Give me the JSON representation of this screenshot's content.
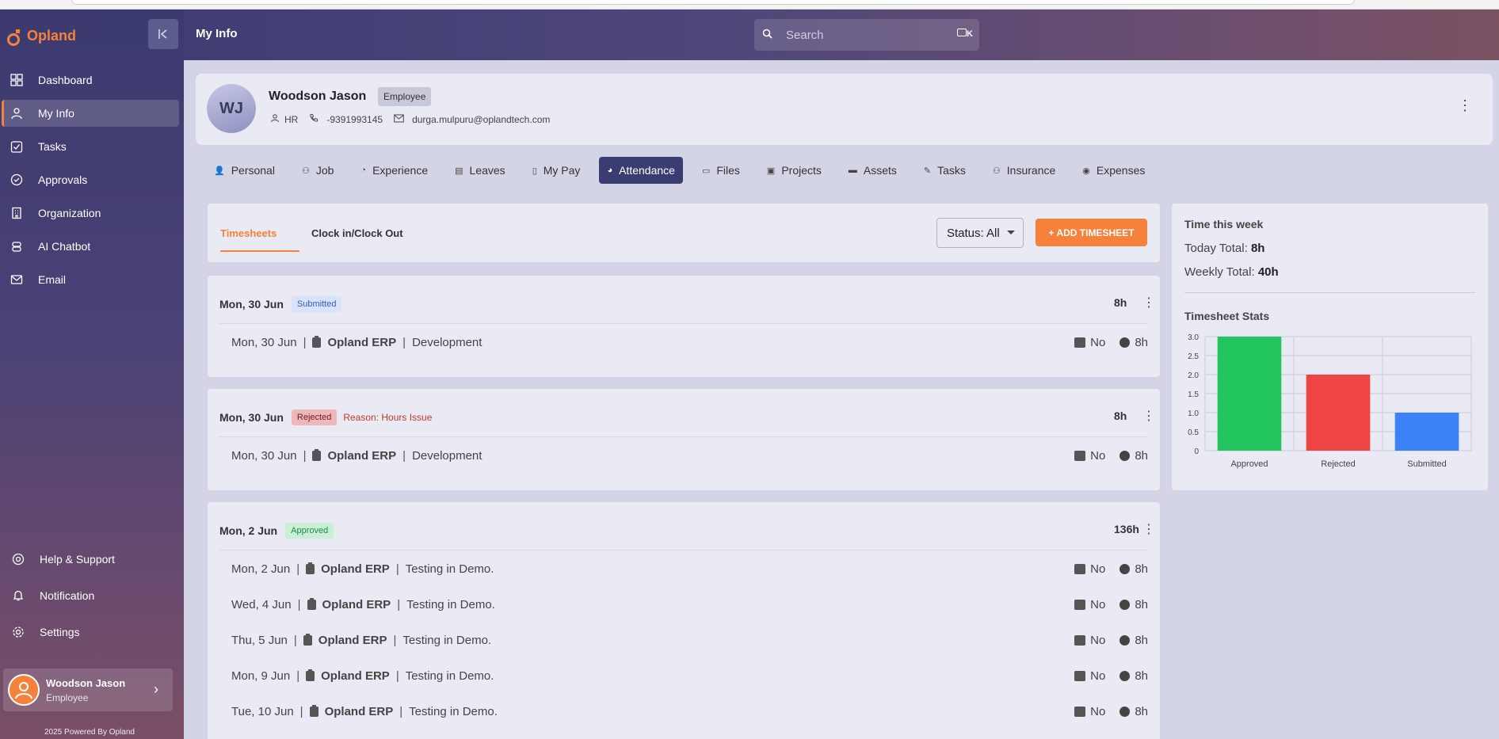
{
  "brand": {
    "name": "Opland"
  },
  "header": {
    "title": "My Info",
    "search_placeholder": "Search",
    "shortcut": "K"
  },
  "nav": {
    "items": [
      {
        "label": "Dashboard",
        "icon": "dashboard-icon"
      },
      {
        "label": "My Info",
        "icon": "user-icon",
        "active": true
      },
      {
        "label": "Tasks",
        "icon": "tasks-icon"
      },
      {
        "label": "Approvals",
        "icon": "approvals-icon"
      },
      {
        "label": "Organization",
        "icon": "organization-icon"
      },
      {
        "label": "AI Chatbot",
        "icon": "chatbot-icon"
      },
      {
        "label": "Email",
        "icon": "email-icon"
      }
    ],
    "bottom": [
      {
        "label": "Help & Support",
        "icon": "help-icon"
      },
      {
        "label": "Notification",
        "icon": "bell-icon"
      },
      {
        "label": "Settings",
        "icon": "gear-icon"
      }
    ]
  },
  "user": {
    "name": "Woodson Jason",
    "role": "Employee"
  },
  "footer": "2025 Powered By Opland",
  "profile": {
    "initials": "WJ",
    "name": "Woodson Jason",
    "badge": "Employee",
    "department": "HR",
    "phone": "-9391993145",
    "email": "durga.mulpuru@oplandtech.com"
  },
  "tabs": [
    "Personal",
    "Job",
    "Experience",
    "Leaves",
    "My Pay",
    "Attendance",
    "Files",
    "Projects",
    "Assets",
    "Tasks",
    "Insurance",
    "Expenses"
  ],
  "active_tab": "Attendance",
  "timesheet": {
    "tabs": [
      "Timesheets",
      "Clock in/Clock Out"
    ],
    "status_filter": "Status: All",
    "add_button": "+ ADD TIMESHEET",
    "groups": [
      {
        "date": "Mon, 30 Jun",
        "status": "Submitted",
        "reason": "",
        "hours": "8h",
        "entries": [
          {
            "date": "Mon, 30 Jun",
            "project": "Opland ERP",
            "task": "Development",
            "billable": "No",
            "hours": "8h"
          }
        ]
      },
      {
        "date": "Mon, 30 Jun",
        "status": "Rejected",
        "reason": "Reason: Hours Issue",
        "hours": "8h",
        "entries": [
          {
            "date": "Mon, 30 Jun",
            "project": "Opland ERP",
            "task": "Development",
            "billable": "No",
            "hours": "8h"
          }
        ]
      },
      {
        "date": "Mon, 2 Jun",
        "status": "Approved",
        "reason": "",
        "hours": "136h",
        "entries": [
          {
            "date": "Mon, 2 Jun",
            "project": "Opland ERP",
            "task": "Testing in Demo.",
            "billable": "No",
            "hours": "8h"
          },
          {
            "date": "Wed, 4 Jun",
            "project": "Opland ERP",
            "task": "Testing in Demo.",
            "billable": "No",
            "hours": "8h"
          },
          {
            "date": "Thu, 5 Jun",
            "project": "Opland ERP",
            "task": "Testing in Demo.",
            "billable": "No",
            "hours": "8h"
          },
          {
            "date": "Mon, 9 Jun",
            "project": "Opland ERP",
            "task": "Testing in Demo.",
            "billable": "No",
            "hours": "8h"
          },
          {
            "date": "Tue, 10 Jun",
            "project": "Opland ERP",
            "task": "Testing in Demo.",
            "billable": "No",
            "hours": "8h"
          }
        ]
      }
    ]
  },
  "week": {
    "title": "Time this week",
    "today_label": "Today Total:",
    "today_value": "8h",
    "weekly_label": "Weekly Total:",
    "weekly_value": "40h",
    "stats_title": "Timesheet Stats"
  },
  "chart_data": {
    "type": "bar",
    "categories": [
      "Approved",
      "Rejected",
      "Submitted"
    ],
    "values": [
      3,
      2,
      1
    ],
    "colors": [
      "#22c55e",
      "#ef4444",
      "#3b82f6"
    ],
    "ylim": [
      0,
      3
    ],
    "yticks": [
      "0",
      "0.5",
      "1.0",
      "1.5",
      "2.0",
      "2.5",
      "3.0"
    ],
    "grid": true
  }
}
